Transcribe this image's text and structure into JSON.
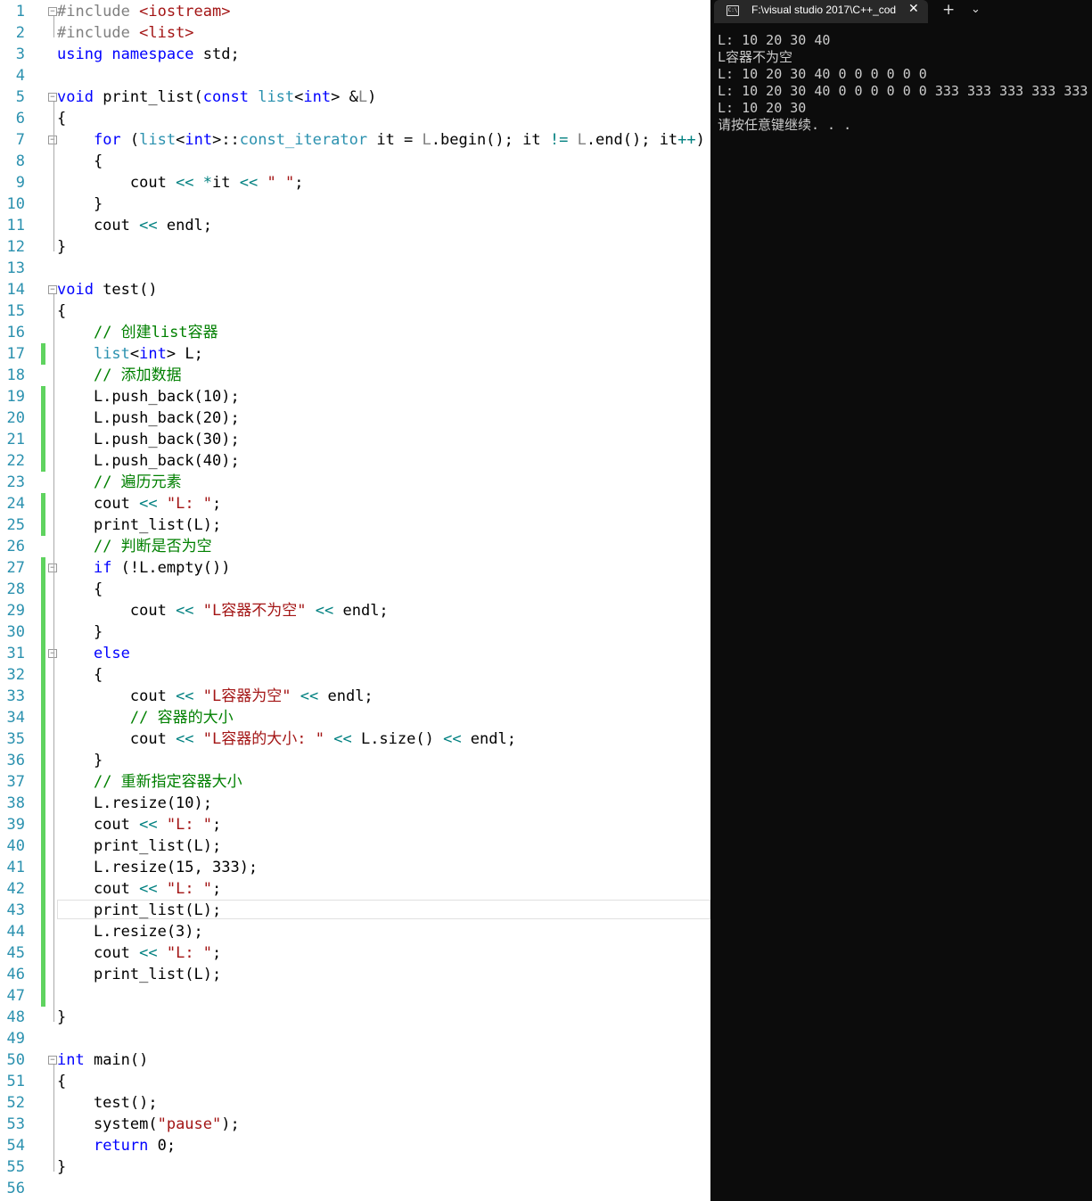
{
  "editor": {
    "lines": [
      {
        "n": "1",
        "fold": "minus",
        "changed": false,
        "segs": [
          {
            "t": "#include ",
            "c": "pp"
          },
          {
            "t": "<iostream>",
            "c": "str"
          }
        ]
      },
      {
        "n": "2",
        "fold": "",
        "changed": false,
        "segs": [
          {
            "t": "#include ",
            "c": "pp"
          },
          {
            "t": "<list>",
            "c": "str"
          }
        ]
      },
      {
        "n": "3",
        "fold": "",
        "changed": false,
        "segs": [
          {
            "t": "using namespace ",
            "c": "kw"
          },
          {
            "t": "std;",
            "c": ""
          }
        ]
      },
      {
        "n": "4",
        "fold": "",
        "changed": false,
        "segs": []
      },
      {
        "n": "5",
        "fold": "minus",
        "changed": false,
        "segs": [
          {
            "t": "void ",
            "c": "kw"
          },
          {
            "t": "print_list(",
            "c": ""
          },
          {
            "t": "const ",
            "c": "kw"
          },
          {
            "t": "list",
            "c": "tp"
          },
          {
            "t": "<",
            "c": ""
          },
          {
            "t": "int",
            "c": "kw"
          },
          {
            "t": "> &",
            "c": ""
          },
          {
            "t": "L",
            "c": "pp"
          },
          {
            "t": ")",
            "c": ""
          }
        ]
      },
      {
        "n": "6",
        "fold": "",
        "changed": false,
        "segs": [
          {
            "t": "{",
            "c": ""
          }
        ]
      },
      {
        "n": "7",
        "fold": "minus",
        "changed": false,
        "segs": [
          {
            "t": "    ",
            "c": ""
          },
          {
            "t": "for ",
            "c": "kw"
          },
          {
            "t": "(",
            "c": ""
          },
          {
            "t": "list",
            "c": "tp"
          },
          {
            "t": "<",
            "c": ""
          },
          {
            "t": "int",
            "c": "kw"
          },
          {
            "t": ">::",
            "c": ""
          },
          {
            "t": "const_iterator",
            "c": "tp"
          },
          {
            "t": " it = ",
            "c": ""
          },
          {
            "t": "L",
            "c": "pp"
          },
          {
            "t": ".begin(); it ",
            "c": ""
          },
          {
            "t": "!=",
            "c": "op"
          },
          {
            "t": " ",
            "c": ""
          },
          {
            "t": "L",
            "c": "pp"
          },
          {
            "t": ".end(); it",
            "c": ""
          },
          {
            "t": "++",
            "c": "op"
          },
          {
            "t": ")",
            "c": ""
          }
        ]
      },
      {
        "n": "8",
        "fold": "",
        "changed": false,
        "segs": [
          {
            "t": "    {",
            "c": ""
          }
        ]
      },
      {
        "n": "9",
        "fold": "",
        "changed": false,
        "segs": [
          {
            "t": "        cout ",
            "c": ""
          },
          {
            "t": "<<",
            "c": "op"
          },
          {
            "t": " ",
            "c": ""
          },
          {
            "t": "*",
            "c": "op"
          },
          {
            "t": "it ",
            "c": ""
          },
          {
            "t": "<<",
            "c": "op"
          },
          {
            "t": " ",
            "c": ""
          },
          {
            "t": "\" \"",
            "c": "str"
          },
          {
            "t": ";",
            "c": ""
          }
        ]
      },
      {
        "n": "10",
        "fold": "",
        "changed": false,
        "segs": [
          {
            "t": "    }",
            "c": ""
          }
        ]
      },
      {
        "n": "11",
        "fold": "",
        "changed": false,
        "segs": [
          {
            "t": "    cout ",
            "c": ""
          },
          {
            "t": "<<",
            "c": "op"
          },
          {
            "t": " endl;",
            "c": ""
          }
        ]
      },
      {
        "n": "12",
        "fold": "",
        "changed": false,
        "segs": [
          {
            "t": "}",
            "c": ""
          }
        ]
      },
      {
        "n": "13",
        "fold": "",
        "changed": false,
        "segs": []
      },
      {
        "n": "14",
        "fold": "minus",
        "changed": false,
        "segs": [
          {
            "t": "void ",
            "c": "kw"
          },
          {
            "t": "test()",
            "c": ""
          }
        ]
      },
      {
        "n": "15",
        "fold": "",
        "changed": false,
        "segs": [
          {
            "t": "{",
            "c": ""
          }
        ]
      },
      {
        "n": "16",
        "fold": "",
        "changed": false,
        "segs": [
          {
            "t": "    ",
            "c": ""
          },
          {
            "t": "// 创建list容器",
            "c": "cm"
          }
        ]
      },
      {
        "n": "17",
        "fold": "",
        "changed": true,
        "segs": [
          {
            "t": "    ",
            "c": ""
          },
          {
            "t": "list",
            "c": "tp"
          },
          {
            "t": "<",
            "c": ""
          },
          {
            "t": "int",
            "c": "kw"
          },
          {
            "t": "> L;",
            "c": ""
          }
        ]
      },
      {
        "n": "18",
        "fold": "",
        "changed": false,
        "segs": [
          {
            "t": "    ",
            "c": ""
          },
          {
            "t": "// 添加数据",
            "c": "cm"
          }
        ]
      },
      {
        "n": "19",
        "fold": "",
        "changed": true,
        "segs": [
          {
            "t": "    L.push_back(10);",
            "c": ""
          }
        ]
      },
      {
        "n": "20",
        "fold": "",
        "changed": true,
        "segs": [
          {
            "t": "    L.push_back(20);",
            "c": ""
          }
        ]
      },
      {
        "n": "21",
        "fold": "",
        "changed": true,
        "segs": [
          {
            "t": "    L.push_back(30);",
            "c": ""
          }
        ]
      },
      {
        "n": "22",
        "fold": "",
        "changed": true,
        "segs": [
          {
            "t": "    L.push_back(40);",
            "c": ""
          }
        ]
      },
      {
        "n": "23",
        "fold": "",
        "changed": false,
        "segs": [
          {
            "t": "    ",
            "c": ""
          },
          {
            "t": "// 遍历元素",
            "c": "cm"
          }
        ]
      },
      {
        "n": "24",
        "fold": "",
        "changed": true,
        "segs": [
          {
            "t": "    cout ",
            "c": ""
          },
          {
            "t": "<<",
            "c": "op"
          },
          {
            "t": " ",
            "c": ""
          },
          {
            "t": "\"L: \"",
            "c": "str"
          },
          {
            "t": ";",
            "c": ""
          }
        ]
      },
      {
        "n": "25",
        "fold": "",
        "changed": true,
        "segs": [
          {
            "t": "    print_list(L);",
            "c": ""
          }
        ]
      },
      {
        "n": "26",
        "fold": "",
        "changed": false,
        "segs": [
          {
            "t": "    ",
            "c": ""
          },
          {
            "t": "// 判断是否为空",
            "c": "cm"
          }
        ]
      },
      {
        "n": "27",
        "fold": "minus",
        "changed": true,
        "segs": [
          {
            "t": "    ",
            "c": ""
          },
          {
            "t": "if ",
            "c": "kw"
          },
          {
            "t": "(!L.empty())",
            "c": ""
          }
        ]
      },
      {
        "n": "28",
        "fold": "",
        "changed": true,
        "segs": [
          {
            "t": "    {",
            "c": ""
          }
        ]
      },
      {
        "n": "29",
        "fold": "",
        "changed": true,
        "segs": [
          {
            "t": "        cout ",
            "c": ""
          },
          {
            "t": "<<",
            "c": "op"
          },
          {
            "t": " ",
            "c": ""
          },
          {
            "t": "\"L容器不为空\"",
            "c": "str"
          },
          {
            "t": " ",
            "c": ""
          },
          {
            "t": "<<",
            "c": "op"
          },
          {
            "t": " endl;",
            "c": ""
          }
        ]
      },
      {
        "n": "30",
        "fold": "",
        "changed": true,
        "segs": [
          {
            "t": "    }",
            "c": ""
          }
        ]
      },
      {
        "n": "31",
        "fold": "minus",
        "changed": true,
        "segs": [
          {
            "t": "    ",
            "c": ""
          },
          {
            "t": "else",
            "c": "kw"
          }
        ]
      },
      {
        "n": "32",
        "fold": "",
        "changed": true,
        "segs": [
          {
            "t": "    {",
            "c": ""
          }
        ]
      },
      {
        "n": "33",
        "fold": "",
        "changed": true,
        "segs": [
          {
            "t": "        cout ",
            "c": ""
          },
          {
            "t": "<<",
            "c": "op"
          },
          {
            "t": " ",
            "c": ""
          },
          {
            "t": "\"L容器为空\"",
            "c": "str"
          },
          {
            "t": " ",
            "c": ""
          },
          {
            "t": "<<",
            "c": "op"
          },
          {
            "t": " endl;",
            "c": ""
          }
        ]
      },
      {
        "n": "34",
        "fold": "",
        "changed": true,
        "segs": [
          {
            "t": "        ",
            "c": ""
          },
          {
            "t": "// 容器的大小",
            "c": "cm"
          }
        ]
      },
      {
        "n": "35",
        "fold": "",
        "changed": true,
        "segs": [
          {
            "t": "        cout ",
            "c": ""
          },
          {
            "t": "<<",
            "c": "op"
          },
          {
            "t": " ",
            "c": ""
          },
          {
            "t": "\"L容器的大小: \"",
            "c": "str"
          },
          {
            "t": " ",
            "c": ""
          },
          {
            "t": "<<",
            "c": "op"
          },
          {
            "t": " L.size() ",
            "c": ""
          },
          {
            "t": "<<",
            "c": "op"
          },
          {
            "t": " endl;",
            "c": ""
          }
        ]
      },
      {
        "n": "36",
        "fold": "",
        "changed": true,
        "segs": [
          {
            "t": "    }",
            "c": ""
          }
        ]
      },
      {
        "n": "37",
        "fold": "",
        "changed": true,
        "segs": [
          {
            "t": "    ",
            "c": ""
          },
          {
            "t": "// 重新指定容器大小",
            "c": "cm"
          }
        ]
      },
      {
        "n": "38",
        "fold": "",
        "changed": true,
        "segs": [
          {
            "t": "    L.resize(10);",
            "c": ""
          }
        ]
      },
      {
        "n": "39",
        "fold": "",
        "changed": true,
        "segs": [
          {
            "t": "    cout ",
            "c": ""
          },
          {
            "t": "<<",
            "c": "op"
          },
          {
            "t": " ",
            "c": ""
          },
          {
            "t": "\"L: \"",
            "c": "str"
          },
          {
            "t": ";",
            "c": ""
          }
        ]
      },
      {
        "n": "40",
        "fold": "",
        "changed": true,
        "segs": [
          {
            "t": "    print_list(L);",
            "c": ""
          }
        ]
      },
      {
        "n": "41",
        "fold": "",
        "changed": true,
        "segs": [
          {
            "t": "    L.resize(15, 333);",
            "c": ""
          }
        ]
      },
      {
        "n": "42",
        "fold": "",
        "changed": true,
        "segs": [
          {
            "t": "    cout ",
            "c": ""
          },
          {
            "t": "<<",
            "c": "op"
          },
          {
            "t": " ",
            "c": ""
          },
          {
            "t": "\"L: \"",
            "c": "str"
          },
          {
            "t": ";",
            "c": ""
          }
        ]
      },
      {
        "n": "43",
        "fold": "",
        "changed": true,
        "segs": [
          {
            "t": "    print_list(L);",
            "c": ""
          }
        ]
      },
      {
        "n": "44",
        "fold": "",
        "changed": true,
        "segs": [
          {
            "t": "    L.resize(3);",
            "c": ""
          }
        ]
      },
      {
        "n": "45",
        "fold": "",
        "changed": true,
        "segs": [
          {
            "t": "    cout ",
            "c": ""
          },
          {
            "t": "<<",
            "c": "op"
          },
          {
            "t": " ",
            "c": ""
          },
          {
            "t": "\"L: \"",
            "c": "str"
          },
          {
            "t": ";",
            "c": ""
          }
        ]
      },
      {
        "n": "46",
        "fold": "",
        "changed": true,
        "segs": [
          {
            "t": "    print_list(L);",
            "c": ""
          }
        ]
      },
      {
        "n": "47",
        "fold": "",
        "changed": true,
        "segs": []
      },
      {
        "n": "48",
        "fold": "",
        "changed": false,
        "segs": [
          {
            "t": "}",
            "c": ""
          }
        ]
      },
      {
        "n": "49",
        "fold": "",
        "changed": false,
        "segs": []
      },
      {
        "n": "50",
        "fold": "minus",
        "changed": false,
        "segs": [
          {
            "t": "int ",
            "c": "kw"
          },
          {
            "t": "main()",
            "c": ""
          }
        ]
      },
      {
        "n": "51",
        "fold": "",
        "changed": false,
        "segs": [
          {
            "t": "{",
            "c": ""
          }
        ]
      },
      {
        "n": "52",
        "fold": "",
        "changed": false,
        "segs": [
          {
            "t": "    test();",
            "c": ""
          }
        ]
      },
      {
        "n": "53",
        "fold": "",
        "changed": false,
        "segs": [
          {
            "t": "    system(",
            "c": ""
          },
          {
            "t": "\"pause\"",
            "c": "str"
          },
          {
            "t": ");",
            "c": ""
          }
        ]
      },
      {
        "n": "54",
        "fold": "",
        "changed": false,
        "segs": [
          {
            "t": "    ",
            "c": ""
          },
          {
            "t": "return ",
            "c": "kw"
          },
          {
            "t": "0;",
            "c": ""
          }
        ]
      },
      {
        "n": "55",
        "fold": "",
        "changed": false,
        "segs": [
          {
            "t": "}",
            "c": ""
          }
        ]
      },
      {
        "n": "56",
        "fold": "",
        "changed": false,
        "segs": []
      }
    ]
  },
  "terminal": {
    "tab_title": "F:\\visual studio 2017\\C++_cod",
    "tab_icon": "console-icon",
    "close_glyph": "✕",
    "new_tab_glyph": "+",
    "dropdown_glyph": "⌄",
    "output": [
      "L: 10 20 30 40",
      "L容器不为空",
      "L: 10 20 30 40 0 0 0 0 0 0",
      "L: 10 20 30 40 0 0 0 0 0 0 333 333 333 333 333",
      "L: 10 20 30",
      "请按任意键继续. . ."
    ]
  },
  "colors": {
    "keyword": "#0000ff",
    "type": "#2b91af",
    "string": "#a31515",
    "comment": "#008000",
    "changed_marker": "#5fd35f",
    "terminal_bg": "#0c0c0c",
    "terminal_text": "#cccccc"
  }
}
